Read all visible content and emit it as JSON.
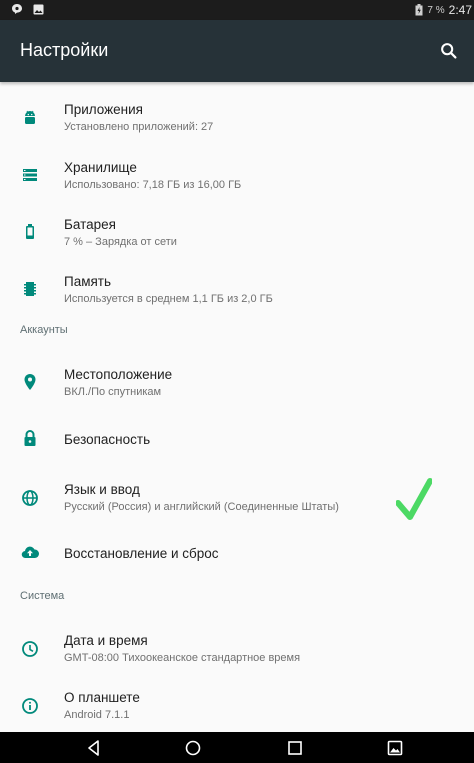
{
  "status_bar": {
    "battery_percent": "7 %",
    "time": "2:47"
  },
  "app_bar": {
    "title": "Настройки",
    "search_icon": "search-icon"
  },
  "colors": {
    "app_bar_bg": "#263238",
    "accent": "#00897b",
    "checkmark": "#4cd964"
  },
  "device": {
    "apps": {
      "title": "Приложения",
      "summary": "Установлено приложений: 27",
      "icon": "android-icon"
    },
    "storage": {
      "title": "Хранилище",
      "summary": "Использовано: 7,18 ГБ из 16,00 ГБ",
      "icon": "storage-icon"
    },
    "battery": {
      "title": "Батарея",
      "summary": "7 % – Зарядка от сети",
      "icon": "battery-icon"
    },
    "memory": {
      "title": "Память",
      "summary": "Используется в среднем 1,1 ГБ из 2,0 ГБ",
      "icon": "memory-icon"
    }
  },
  "accounts_header": "Аккаунты",
  "personal": {
    "location": {
      "title": "Местоположение",
      "summary": "ВКЛ./По спутникам",
      "icon": "location-icon"
    },
    "security": {
      "title": "Безопасность",
      "icon": "lock-icon"
    },
    "language": {
      "title": "Язык и ввод",
      "summary": "Русский (Россия) и английский (Соединенные Штаты)",
      "icon": "globe-icon"
    },
    "backup": {
      "title": "Восстановление и сброс",
      "icon": "cloud-upload-icon"
    }
  },
  "system_header": "Система",
  "system": {
    "datetime": {
      "title": "Дата и время",
      "summary": "GMT-08:00 Тихоокеанское стандартное время",
      "icon": "clock-icon"
    },
    "about": {
      "title": "О планшете",
      "summary": "Android 7.1.1",
      "icon": "info-icon"
    }
  },
  "nav": [
    "back-icon",
    "home-icon",
    "recents-icon",
    "screenshot-icon"
  ]
}
